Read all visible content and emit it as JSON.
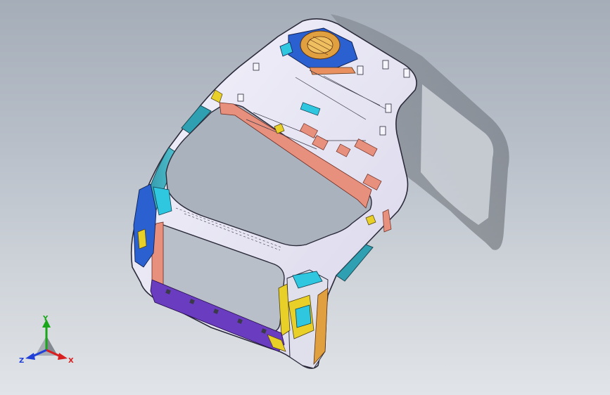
{
  "viewport": {
    "background_top": "#a5adb8",
    "background_bottom": "#e1e4e8"
  },
  "model": {
    "body_color": "#e8e6f4",
    "edge_color": "#2a2a3a",
    "accent_colors": {
      "cyan": "#2fc6e0",
      "salmon": "#e8907e",
      "yellow": "#e8d028",
      "purple": "#6a3cc0",
      "orange": "#e0a040",
      "blue": "#2a60d0"
    }
  },
  "triad": {
    "axes": [
      {
        "id": "y",
        "label": "Y",
        "color": "#1aa61a"
      },
      {
        "id": "x",
        "label": "X",
        "color": "#d81e1e"
      },
      {
        "id": "z",
        "label": "Z",
        "color": "#2040d8"
      }
    ]
  }
}
